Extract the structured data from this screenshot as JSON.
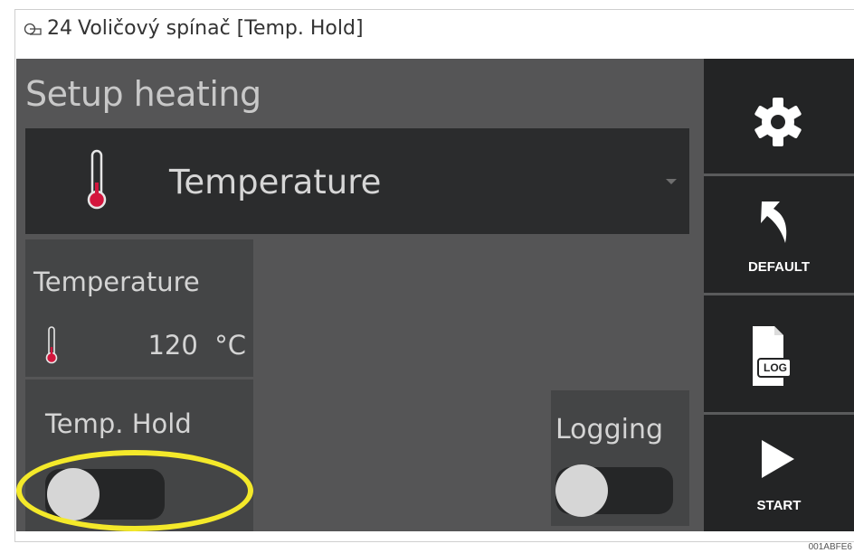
{
  "figure": {
    "number": "24",
    "title": "Voličový spínač [Temp. Hold]"
  },
  "screen": {
    "title": "Setup heating",
    "dropdown": {
      "icon": "thermometer-icon",
      "selected": "Temperature"
    },
    "temperature_card": {
      "title": "Temperature",
      "value": "120",
      "unit": "°C",
      "icon": "thermometer-icon"
    },
    "temp_hold": {
      "label": "Temp. Hold",
      "state": "off"
    },
    "logging": {
      "label": "Logging",
      "state": "off"
    }
  },
  "sidebar": {
    "settings": {
      "icon": "gear-icon"
    },
    "default": {
      "icon": "undo-arrow-icon",
      "label": "DEFAULT"
    },
    "log": {
      "icon": "log-file-icon",
      "label": "LOG"
    },
    "start": {
      "icon": "play-icon",
      "label": "START"
    }
  },
  "doc_code": "001ABFE6",
  "colors": {
    "highlight": "#f4e92a",
    "thermometer": "#d3163d",
    "background": "#555556"
  }
}
